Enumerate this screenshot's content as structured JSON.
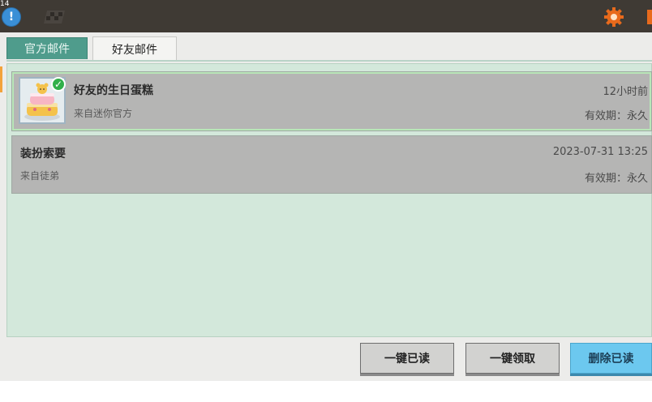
{
  "topbar": {
    "corner_text": "14",
    "info_label": "!",
    "icons": [
      "info-icon",
      "flag-icon",
      "gear-icon"
    ],
    "accent_color": "#e86a1c"
  },
  "tabs": [
    {
      "label": "官方邮件",
      "active": false
    },
    {
      "label": "好友邮件",
      "active": true
    }
  ],
  "mails": [
    {
      "title": "好友的生日蛋糕",
      "sender": "来自迷你官方",
      "time": "12小时前",
      "validity": "有效期：永久",
      "has_attachment_claimed": true,
      "icon": "birthday-cake-icon"
    },
    {
      "title": "装扮索要",
      "sender": "来自徒弟",
      "time": "2023-07-31 13:25",
      "validity": "有效期：永久"
    }
  ],
  "actions": {
    "read_all": "一键已读",
    "claim_all": "一键领取",
    "delete_read": "删除已读"
  }
}
